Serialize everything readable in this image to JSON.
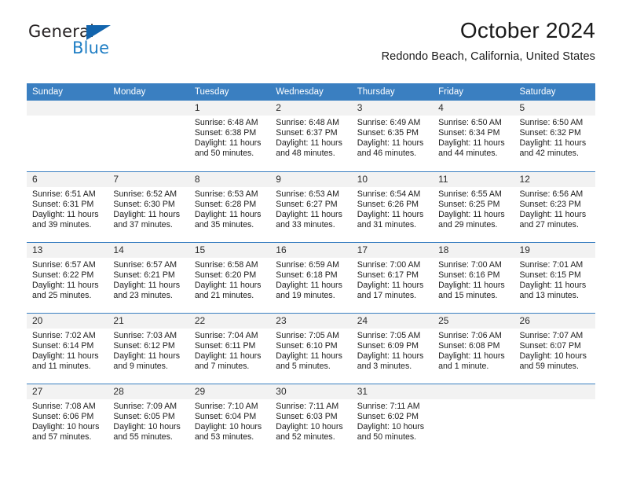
{
  "brand": {
    "name_top": "General",
    "name_bottom": "Blue",
    "accent_color": "#1f7ec4",
    "triangle_color": "#1264ad"
  },
  "header": {
    "title": "October 2024",
    "subtitle": "Redondo Beach, California, United States"
  },
  "calendar": {
    "header_bg": "#3a7fc1",
    "header_text_color": "#ffffff",
    "daynum_bg": "#f2f2f2",
    "weekdays": [
      "Sunday",
      "Monday",
      "Tuesday",
      "Wednesday",
      "Thursday",
      "Friday",
      "Saturday"
    ],
    "weeks": [
      [
        {
          "day": "",
          "sunrise": "",
          "sunset": "",
          "daylight1": "",
          "daylight2": ""
        },
        {
          "day": "",
          "sunrise": "",
          "sunset": "",
          "daylight1": "",
          "daylight2": ""
        },
        {
          "day": "1",
          "sunrise": "Sunrise: 6:48 AM",
          "sunset": "Sunset: 6:38 PM",
          "daylight1": "Daylight: 11 hours",
          "daylight2": "and 50 minutes."
        },
        {
          "day": "2",
          "sunrise": "Sunrise: 6:48 AM",
          "sunset": "Sunset: 6:37 PM",
          "daylight1": "Daylight: 11 hours",
          "daylight2": "and 48 minutes."
        },
        {
          "day": "3",
          "sunrise": "Sunrise: 6:49 AM",
          "sunset": "Sunset: 6:35 PM",
          "daylight1": "Daylight: 11 hours",
          "daylight2": "and 46 minutes."
        },
        {
          "day": "4",
          "sunrise": "Sunrise: 6:50 AM",
          "sunset": "Sunset: 6:34 PM",
          "daylight1": "Daylight: 11 hours",
          "daylight2": "and 44 minutes."
        },
        {
          "day": "5",
          "sunrise": "Sunrise: 6:50 AM",
          "sunset": "Sunset: 6:32 PM",
          "daylight1": "Daylight: 11 hours",
          "daylight2": "and 42 minutes."
        }
      ],
      [
        {
          "day": "6",
          "sunrise": "Sunrise: 6:51 AM",
          "sunset": "Sunset: 6:31 PM",
          "daylight1": "Daylight: 11 hours",
          "daylight2": "and 39 minutes."
        },
        {
          "day": "7",
          "sunrise": "Sunrise: 6:52 AM",
          "sunset": "Sunset: 6:30 PM",
          "daylight1": "Daylight: 11 hours",
          "daylight2": "and 37 minutes."
        },
        {
          "day": "8",
          "sunrise": "Sunrise: 6:53 AM",
          "sunset": "Sunset: 6:28 PM",
          "daylight1": "Daylight: 11 hours",
          "daylight2": "and 35 minutes."
        },
        {
          "day": "9",
          "sunrise": "Sunrise: 6:53 AM",
          "sunset": "Sunset: 6:27 PM",
          "daylight1": "Daylight: 11 hours",
          "daylight2": "and 33 minutes."
        },
        {
          "day": "10",
          "sunrise": "Sunrise: 6:54 AM",
          "sunset": "Sunset: 6:26 PM",
          "daylight1": "Daylight: 11 hours",
          "daylight2": "and 31 minutes."
        },
        {
          "day": "11",
          "sunrise": "Sunrise: 6:55 AM",
          "sunset": "Sunset: 6:25 PM",
          "daylight1": "Daylight: 11 hours",
          "daylight2": "and 29 minutes."
        },
        {
          "day": "12",
          "sunrise": "Sunrise: 6:56 AM",
          "sunset": "Sunset: 6:23 PM",
          "daylight1": "Daylight: 11 hours",
          "daylight2": "and 27 minutes."
        }
      ],
      [
        {
          "day": "13",
          "sunrise": "Sunrise: 6:57 AM",
          "sunset": "Sunset: 6:22 PM",
          "daylight1": "Daylight: 11 hours",
          "daylight2": "and 25 minutes."
        },
        {
          "day": "14",
          "sunrise": "Sunrise: 6:57 AM",
          "sunset": "Sunset: 6:21 PM",
          "daylight1": "Daylight: 11 hours",
          "daylight2": "and 23 minutes."
        },
        {
          "day": "15",
          "sunrise": "Sunrise: 6:58 AM",
          "sunset": "Sunset: 6:20 PM",
          "daylight1": "Daylight: 11 hours",
          "daylight2": "and 21 minutes."
        },
        {
          "day": "16",
          "sunrise": "Sunrise: 6:59 AM",
          "sunset": "Sunset: 6:18 PM",
          "daylight1": "Daylight: 11 hours",
          "daylight2": "and 19 minutes."
        },
        {
          "day": "17",
          "sunrise": "Sunrise: 7:00 AM",
          "sunset": "Sunset: 6:17 PM",
          "daylight1": "Daylight: 11 hours",
          "daylight2": "and 17 minutes."
        },
        {
          "day": "18",
          "sunrise": "Sunrise: 7:00 AM",
          "sunset": "Sunset: 6:16 PM",
          "daylight1": "Daylight: 11 hours",
          "daylight2": "and 15 minutes."
        },
        {
          "day": "19",
          "sunrise": "Sunrise: 7:01 AM",
          "sunset": "Sunset: 6:15 PM",
          "daylight1": "Daylight: 11 hours",
          "daylight2": "and 13 minutes."
        }
      ],
      [
        {
          "day": "20",
          "sunrise": "Sunrise: 7:02 AM",
          "sunset": "Sunset: 6:14 PM",
          "daylight1": "Daylight: 11 hours",
          "daylight2": "and 11 minutes."
        },
        {
          "day": "21",
          "sunrise": "Sunrise: 7:03 AM",
          "sunset": "Sunset: 6:12 PM",
          "daylight1": "Daylight: 11 hours",
          "daylight2": "and 9 minutes."
        },
        {
          "day": "22",
          "sunrise": "Sunrise: 7:04 AM",
          "sunset": "Sunset: 6:11 PM",
          "daylight1": "Daylight: 11 hours",
          "daylight2": "and 7 minutes."
        },
        {
          "day": "23",
          "sunrise": "Sunrise: 7:05 AM",
          "sunset": "Sunset: 6:10 PM",
          "daylight1": "Daylight: 11 hours",
          "daylight2": "and 5 minutes."
        },
        {
          "day": "24",
          "sunrise": "Sunrise: 7:05 AM",
          "sunset": "Sunset: 6:09 PM",
          "daylight1": "Daylight: 11 hours",
          "daylight2": "and 3 minutes."
        },
        {
          "day": "25",
          "sunrise": "Sunrise: 7:06 AM",
          "sunset": "Sunset: 6:08 PM",
          "daylight1": "Daylight: 11 hours",
          "daylight2": "and 1 minute."
        },
        {
          "day": "26",
          "sunrise": "Sunrise: 7:07 AM",
          "sunset": "Sunset: 6:07 PM",
          "daylight1": "Daylight: 10 hours",
          "daylight2": "and 59 minutes."
        }
      ],
      [
        {
          "day": "27",
          "sunrise": "Sunrise: 7:08 AM",
          "sunset": "Sunset: 6:06 PM",
          "daylight1": "Daylight: 10 hours",
          "daylight2": "and 57 minutes."
        },
        {
          "day": "28",
          "sunrise": "Sunrise: 7:09 AM",
          "sunset": "Sunset: 6:05 PM",
          "daylight1": "Daylight: 10 hours",
          "daylight2": "and 55 minutes."
        },
        {
          "day": "29",
          "sunrise": "Sunrise: 7:10 AM",
          "sunset": "Sunset: 6:04 PM",
          "daylight1": "Daylight: 10 hours",
          "daylight2": "and 53 minutes."
        },
        {
          "day": "30",
          "sunrise": "Sunrise: 7:11 AM",
          "sunset": "Sunset: 6:03 PM",
          "daylight1": "Daylight: 10 hours",
          "daylight2": "and 52 minutes."
        },
        {
          "day": "31",
          "sunrise": "Sunrise: 7:11 AM",
          "sunset": "Sunset: 6:02 PM",
          "daylight1": "Daylight: 10 hours",
          "daylight2": "and 50 minutes."
        },
        {
          "day": "",
          "sunrise": "",
          "sunset": "",
          "daylight1": "",
          "daylight2": ""
        },
        {
          "day": "",
          "sunrise": "",
          "sunset": "",
          "daylight1": "",
          "daylight2": ""
        }
      ]
    ]
  }
}
